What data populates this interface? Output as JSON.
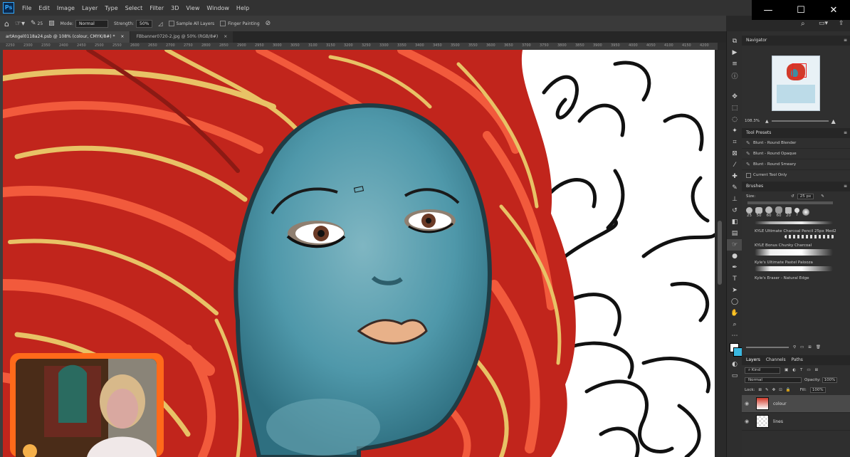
{
  "menu": {
    "app_logo": "Ps",
    "items": [
      "File",
      "Edit",
      "Image",
      "Layer",
      "Type",
      "Select",
      "Filter",
      "3D",
      "View",
      "Window",
      "Help"
    ]
  },
  "window_controls": {
    "minimize": "—",
    "maximize": "☐",
    "close": "✕"
  },
  "options": {
    "brush_size": "25",
    "mode_label": "Mode:",
    "mode_value": "Normal",
    "strength_label": "Strength:",
    "strength_value": "50%",
    "sample_all_layers": "Sample All Layers",
    "finger_painting": "Finger Painting"
  },
  "tabs": [
    {
      "label": "artAngel0118a24.psb @ 108% (colour, CMYK/8#) *",
      "close": "×"
    },
    {
      "label": "FBbanner0720-2.jpg @ 50% (RGB/8#)",
      "close": "×"
    }
  ],
  "ruler_ticks": [
    "2250",
    "2300",
    "2350",
    "2400",
    "2450",
    "2500",
    "2550",
    "2600",
    "2650",
    "2700",
    "2750",
    "2800",
    "2850",
    "2900",
    "2950",
    "3000",
    "3050",
    "3100",
    "3150",
    "3200",
    "3250",
    "3300",
    "3350",
    "3400",
    "3450",
    "3500",
    "3550",
    "3600",
    "3650",
    "3700",
    "3750",
    "3800",
    "3850",
    "3900",
    "3950",
    "4000",
    "4050",
    "4100",
    "4150",
    "4200"
  ],
  "navigator": {
    "title": "Navigator",
    "zoom": "108.3%"
  },
  "tool_presets": {
    "title": "Tool Presets",
    "items": [
      "Blunt - Round Blender",
      "Blunt - Round Opaque",
      "Blunt - Round Smeary"
    ],
    "current_tool_only": "Current Tool Only"
  },
  "brushes": {
    "title": "Brushes",
    "size_label": "Size:",
    "size_value": "25 px",
    "tip_sizes": [
      "25",
      "50",
      "60",
      "60",
      "20",
      "7",
      ""
    ],
    "items": [
      "KYLE Ultimate Charcoal Pencil 25px Med2",
      "KYLE Bonus Chunky Charcoal",
      "Kyle's Ultimate Pastel Palooza",
      "Kyle's Eraser - Natural Edge"
    ]
  },
  "layers": {
    "tabs": [
      "Layers",
      "Channels",
      "Paths"
    ],
    "kind_label": "Kind",
    "blend_mode": "Normal",
    "opacity_label": "Opacity:",
    "opacity_value": "100%",
    "lock_label": "Lock:",
    "fill_label": "Fill:",
    "fill_value": "100%",
    "items": [
      {
        "name": "colour"
      },
      {
        "name": "lines"
      }
    ]
  }
}
